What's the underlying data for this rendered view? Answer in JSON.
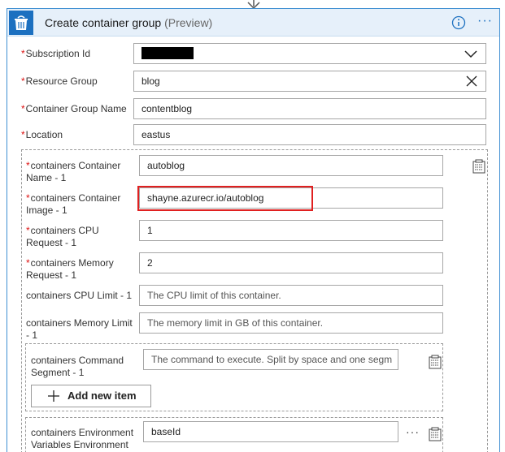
{
  "header": {
    "title": "Create container group",
    "title_suffix": "(Preview)"
  },
  "fields": {
    "subscription": {
      "label": "Subscription Id",
      "required": "*"
    },
    "resource_group": {
      "label": "Resource Group",
      "required": "*",
      "value": "blog"
    },
    "container_group_name": {
      "label": "Container Group Name",
      "required": "*",
      "value": "contentblog"
    },
    "location": {
      "label": "Location",
      "required": "*",
      "value": "eastus"
    }
  },
  "container": {
    "name": {
      "label_line1": "containers Container",
      "label_line2": "Name - 1",
      "required": "*",
      "value": "autoblog"
    },
    "image": {
      "label_line1": "containers Container",
      "label_line2": "Image - 1",
      "required": "*",
      "value": "shayne.azurecr.io/autoblog"
    },
    "cpu_request": {
      "label_line1": "containers CPU",
      "label_line2": "Request - 1",
      "required": "*",
      "value": "1"
    },
    "memory_request": {
      "label_line1": "containers Memory",
      "label_line2": "Request - 1",
      "required": "*",
      "value": "2"
    },
    "cpu_limit": {
      "label": "containers CPU Limit - 1",
      "placeholder": "The CPU limit of this container."
    },
    "memory_limit": {
      "label_line1": "containers Memory Limit",
      "label_line2": "- 1",
      "placeholder": "The memory limit in GB of this container."
    },
    "command": {
      "label_line1": "containers Command",
      "label_line2": "Segment - 1",
      "placeholder": "The command to execute. Split by space and one segm"
    },
    "add_item_label": "Add new item",
    "env": {
      "label_line1": "containers Environment",
      "label_line2": "Variables Environment",
      "value": "baseId",
      "more": "···"
    }
  },
  "colors": {
    "accent": "#1c70c0",
    "highlight": "#e02020",
    "required": "#d11111"
  }
}
